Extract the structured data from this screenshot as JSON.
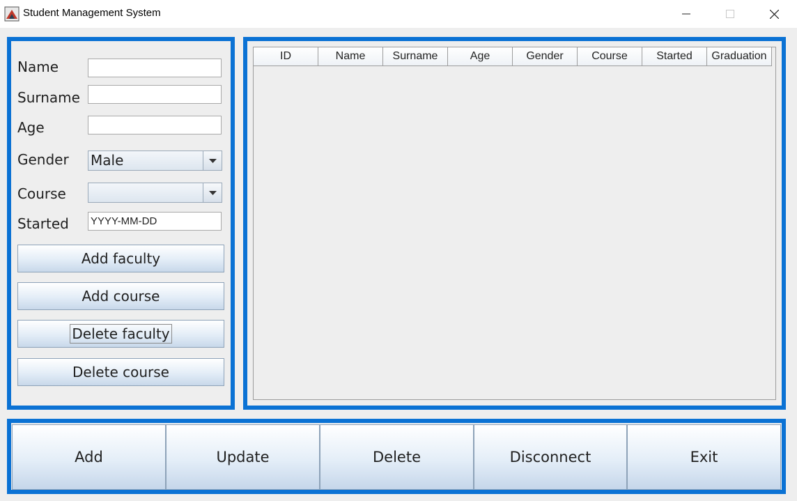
{
  "window": {
    "title": "Student Management System",
    "icons": [
      "java-app-icon",
      "minimize-icon",
      "maximize-icon",
      "close-icon"
    ]
  },
  "form": {
    "name_label": "Name",
    "name_value": "",
    "surname_label": "Surname",
    "surname_value": "",
    "age_label": "Age",
    "age_value": "",
    "gender_label": "Gender",
    "gender_selected": "Male",
    "course_label": "Course",
    "course_selected": "",
    "started_label": "Started",
    "started_value": "YYYY-MM-DD"
  },
  "side_buttons": {
    "add_faculty": "Add faculty",
    "add_course": "Add course",
    "delete_faculty": "Delete faculty",
    "delete_course": "Delete course"
  },
  "table": {
    "columns": [
      "ID",
      "Name",
      "Surname",
      "Age",
      "Gender",
      "Course",
      "Started",
      "Graduation"
    ],
    "rows": []
  },
  "bottom_buttons": {
    "add": "Add",
    "update": "Update",
    "delete": "Delete",
    "disconnect": "Disconnect",
    "exit": "Exit"
  },
  "colors": {
    "panel_border": "#0b72d4",
    "background": "#eeeeee"
  }
}
